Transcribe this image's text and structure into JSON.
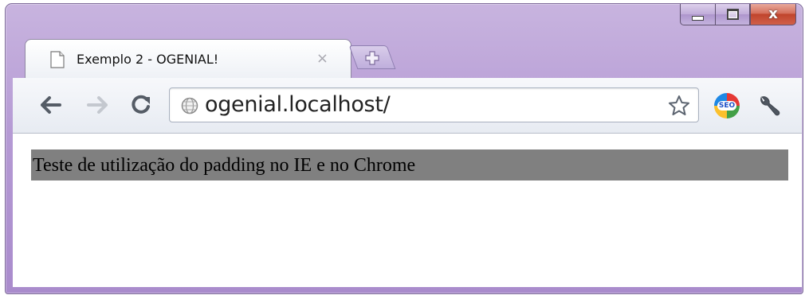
{
  "tab": {
    "title": "Exemplo 2 - OGENIAL!",
    "close_glyph": "×",
    "icon": "page-icon"
  },
  "new_tab": {
    "icon": "new-tab-plus-icon"
  },
  "toolbar": {
    "back_icon": "back-arrow-icon",
    "forward_icon": "forward-arrow-icon",
    "reload_icon": "reload-icon",
    "url": "ogenial.localhost/",
    "bookmark_icon": "star-icon",
    "extension": {
      "label": "SEO",
      "icon": "seo-extension-icon"
    },
    "settings_icon": "wrench-icon"
  },
  "window_controls": {
    "minimize_icon": "minimize-icon",
    "maximize_icon": "maximize-icon",
    "close_icon": "close-icon",
    "close_glyph": "x"
  },
  "page": {
    "text": "Teste de utilização do padding no IE e no Chrome",
    "box_color": "#808080"
  }
}
